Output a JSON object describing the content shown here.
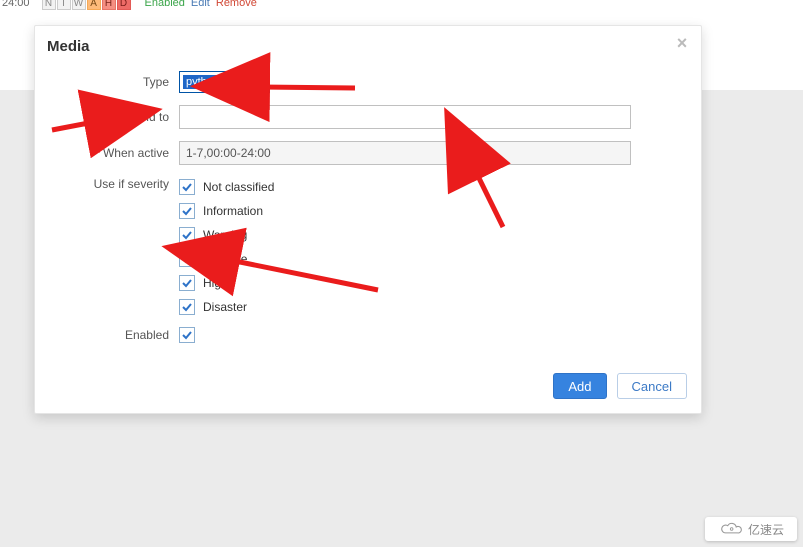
{
  "top": {
    "time": "24:00",
    "sev_cells": [
      "N",
      "I",
      "W",
      "A",
      "H",
      "D"
    ],
    "enabled": "Enabled",
    "edit": "Edit",
    "remove": "Remove"
  },
  "dialog": {
    "title": "Media",
    "labels": {
      "type": "Type",
      "send_to": "Send to",
      "when_active": "When active",
      "use_if_severity": "Use if severity",
      "enabled": "Enabled"
    },
    "type_value": "python email",
    "send_to_value": "",
    "when_active_value": "1-7,00:00-24:00",
    "severities": [
      {
        "key": "not_classified",
        "label": "Not classified",
        "checked": true
      },
      {
        "key": "information",
        "label": "Information",
        "checked": true
      },
      {
        "key": "warning",
        "label": "Warning",
        "checked": true
      },
      {
        "key": "average",
        "label": "Average",
        "checked": true
      },
      {
        "key": "high",
        "label": "High",
        "checked": true
      },
      {
        "key": "disaster",
        "label": "Disaster",
        "checked": true
      }
    ],
    "enabled_checked": true,
    "buttons": {
      "add": "Add",
      "cancel": "Cancel"
    }
  },
  "watermark": "亿速云"
}
